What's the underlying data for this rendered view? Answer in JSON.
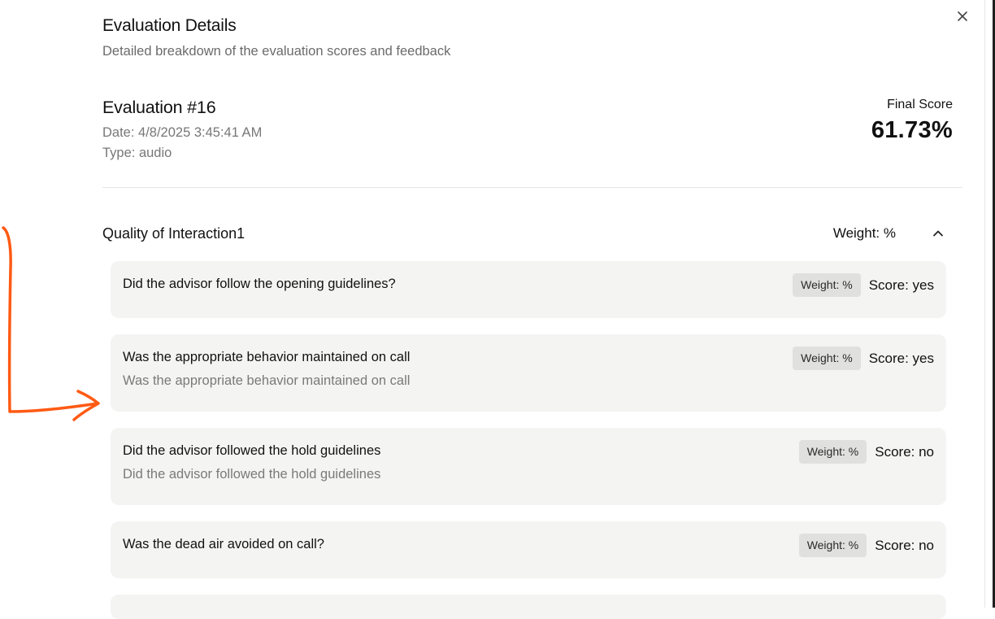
{
  "dialog": {
    "title": "Evaluation Details",
    "subtitle": "Detailed breakdown of the evaluation scores and feedback",
    "close_icon": "close-icon"
  },
  "evaluation": {
    "name": "Evaluation #16",
    "date": "Date: 4/8/2025 3:45:41 AM",
    "type": "Type: audio",
    "final_score_label": "Final Score",
    "final_score_value": "61.73%"
  },
  "section": {
    "title": "Quality of Interaction1",
    "weight": "Weight: %",
    "toggle_icon": "chevron-up-icon",
    "questions": [
      {
        "title": "Did the advisor follow the opening guidelines?",
        "description": "",
        "weight": "Weight: %",
        "score": "Score: yes"
      },
      {
        "title": "Was the appropriate behavior maintained on call",
        "description": "Was the appropriate behavior maintained on call",
        "weight": "Weight: %",
        "score": "Score: yes"
      },
      {
        "title": "Did the advisor followed the hold guidelines",
        "description": "Did the advisor followed the hold guidelines",
        "weight": "Weight: %",
        "score": "Score: no"
      },
      {
        "title": "Was the dead air avoided on call?",
        "description": "",
        "weight": "Weight: %",
        "score": "Score: no"
      }
    ]
  },
  "annotation": {
    "color": "#ff5a14"
  }
}
